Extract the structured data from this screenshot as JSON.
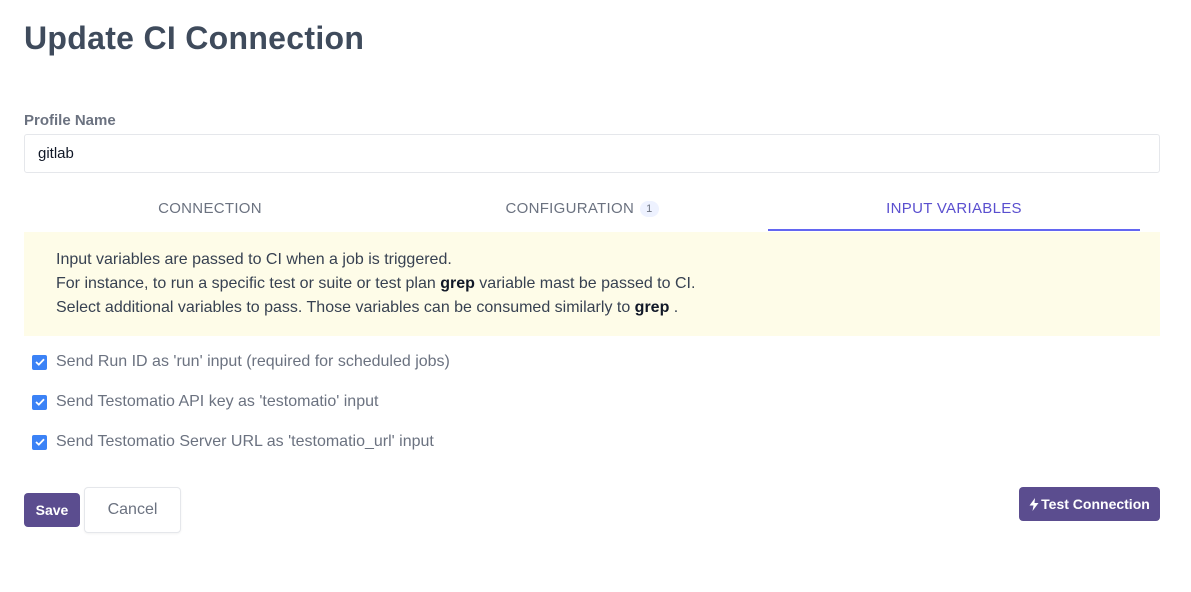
{
  "page": {
    "title": "Update CI Connection"
  },
  "profile": {
    "label": "Profile Name",
    "value": "gitlab"
  },
  "tabs": [
    {
      "label": "CONNECTION",
      "count": null,
      "active": false
    },
    {
      "label": "CONFIGURATION",
      "count": "1",
      "active": false
    },
    {
      "label": "INPUT VARIABLES",
      "count": null,
      "active": true
    }
  ],
  "info": {
    "line1": "Input variables are passed to CI when a job is triggered.",
    "line2_prefix": "For instance, to run a specific test or suite or test plan ",
    "line2_bold": "grep",
    "line2_suffix": " variable mast be passed to CI.",
    "line3_prefix": "Select additional variables to pass. Those variables can be consumed similarly to ",
    "line3_bold": "grep",
    "line3_suffix": " ."
  },
  "options": [
    {
      "label": "Send Run ID as 'run' input (required for scheduled jobs)",
      "checked": true
    },
    {
      "label": "Send Testomatio API key as 'testomatio' input",
      "checked": true
    },
    {
      "label": "Send Testomatio Server URL as 'testomatio_url' input",
      "checked": true
    }
  ],
  "actions": {
    "save": "Save",
    "cancel": "Cancel",
    "test": "Test Connection"
  },
  "colors": {
    "accent": "#5b4d8f",
    "tab_active": "#6366f1",
    "checkbox": "#3b82f6",
    "info_bg": "#fefce8"
  }
}
